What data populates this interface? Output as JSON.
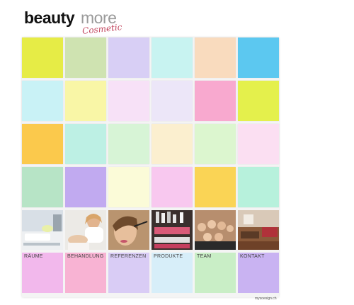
{
  "logo": {
    "word_bold": "beauty",
    "word_light": "more",
    "script": "Cosmetic"
  },
  "tile_colors": [
    [
      "#e6ec46",
      "#cfe3b1",
      "#d8cff5",
      "#c8f3f1",
      "#f9dbbe",
      "#5cc8f0"
    ],
    [
      "#c9f2f6",
      "#f9f6a6",
      "#f7e1f7",
      "#ece6f8",
      "#f8a9cf",
      "#e4f04c"
    ],
    [
      "#fbc94c",
      "#bdf0e4",
      "#d7f4d6",
      "#fbefcf",
      "#dcf6cf",
      "#fbdff2"
    ],
    [
      "#b7e4c6",
      "#c1aaf0",
      "#fbfbd8",
      "#f8c8ef",
      "#fad455",
      "#b7f1dc"
    ]
  ],
  "photos": [
    {
      "icon": "room-photo"
    },
    {
      "icon": "treatment-photo"
    },
    {
      "icon": "makeup-photo"
    },
    {
      "icon": "products-photo"
    },
    {
      "icon": "team-photo"
    },
    {
      "icon": "contact-room-photo"
    }
  ],
  "nav": [
    {
      "label": "RÄUME",
      "color": "#f2b8ec"
    },
    {
      "label": "BEHANDLUNG",
      "color": "#f8b3d3"
    },
    {
      "label": "REFERENZEN",
      "color": "#d9ccf5"
    },
    {
      "label": "PRODUKTE",
      "color": "#d7eef9"
    },
    {
      "label": "TEAM",
      "color": "#c9eec6"
    },
    {
      "label": "KONTAKT",
      "color": "#c9b3f2"
    }
  ],
  "footer": {
    "credit": "mysoesign.ch"
  }
}
